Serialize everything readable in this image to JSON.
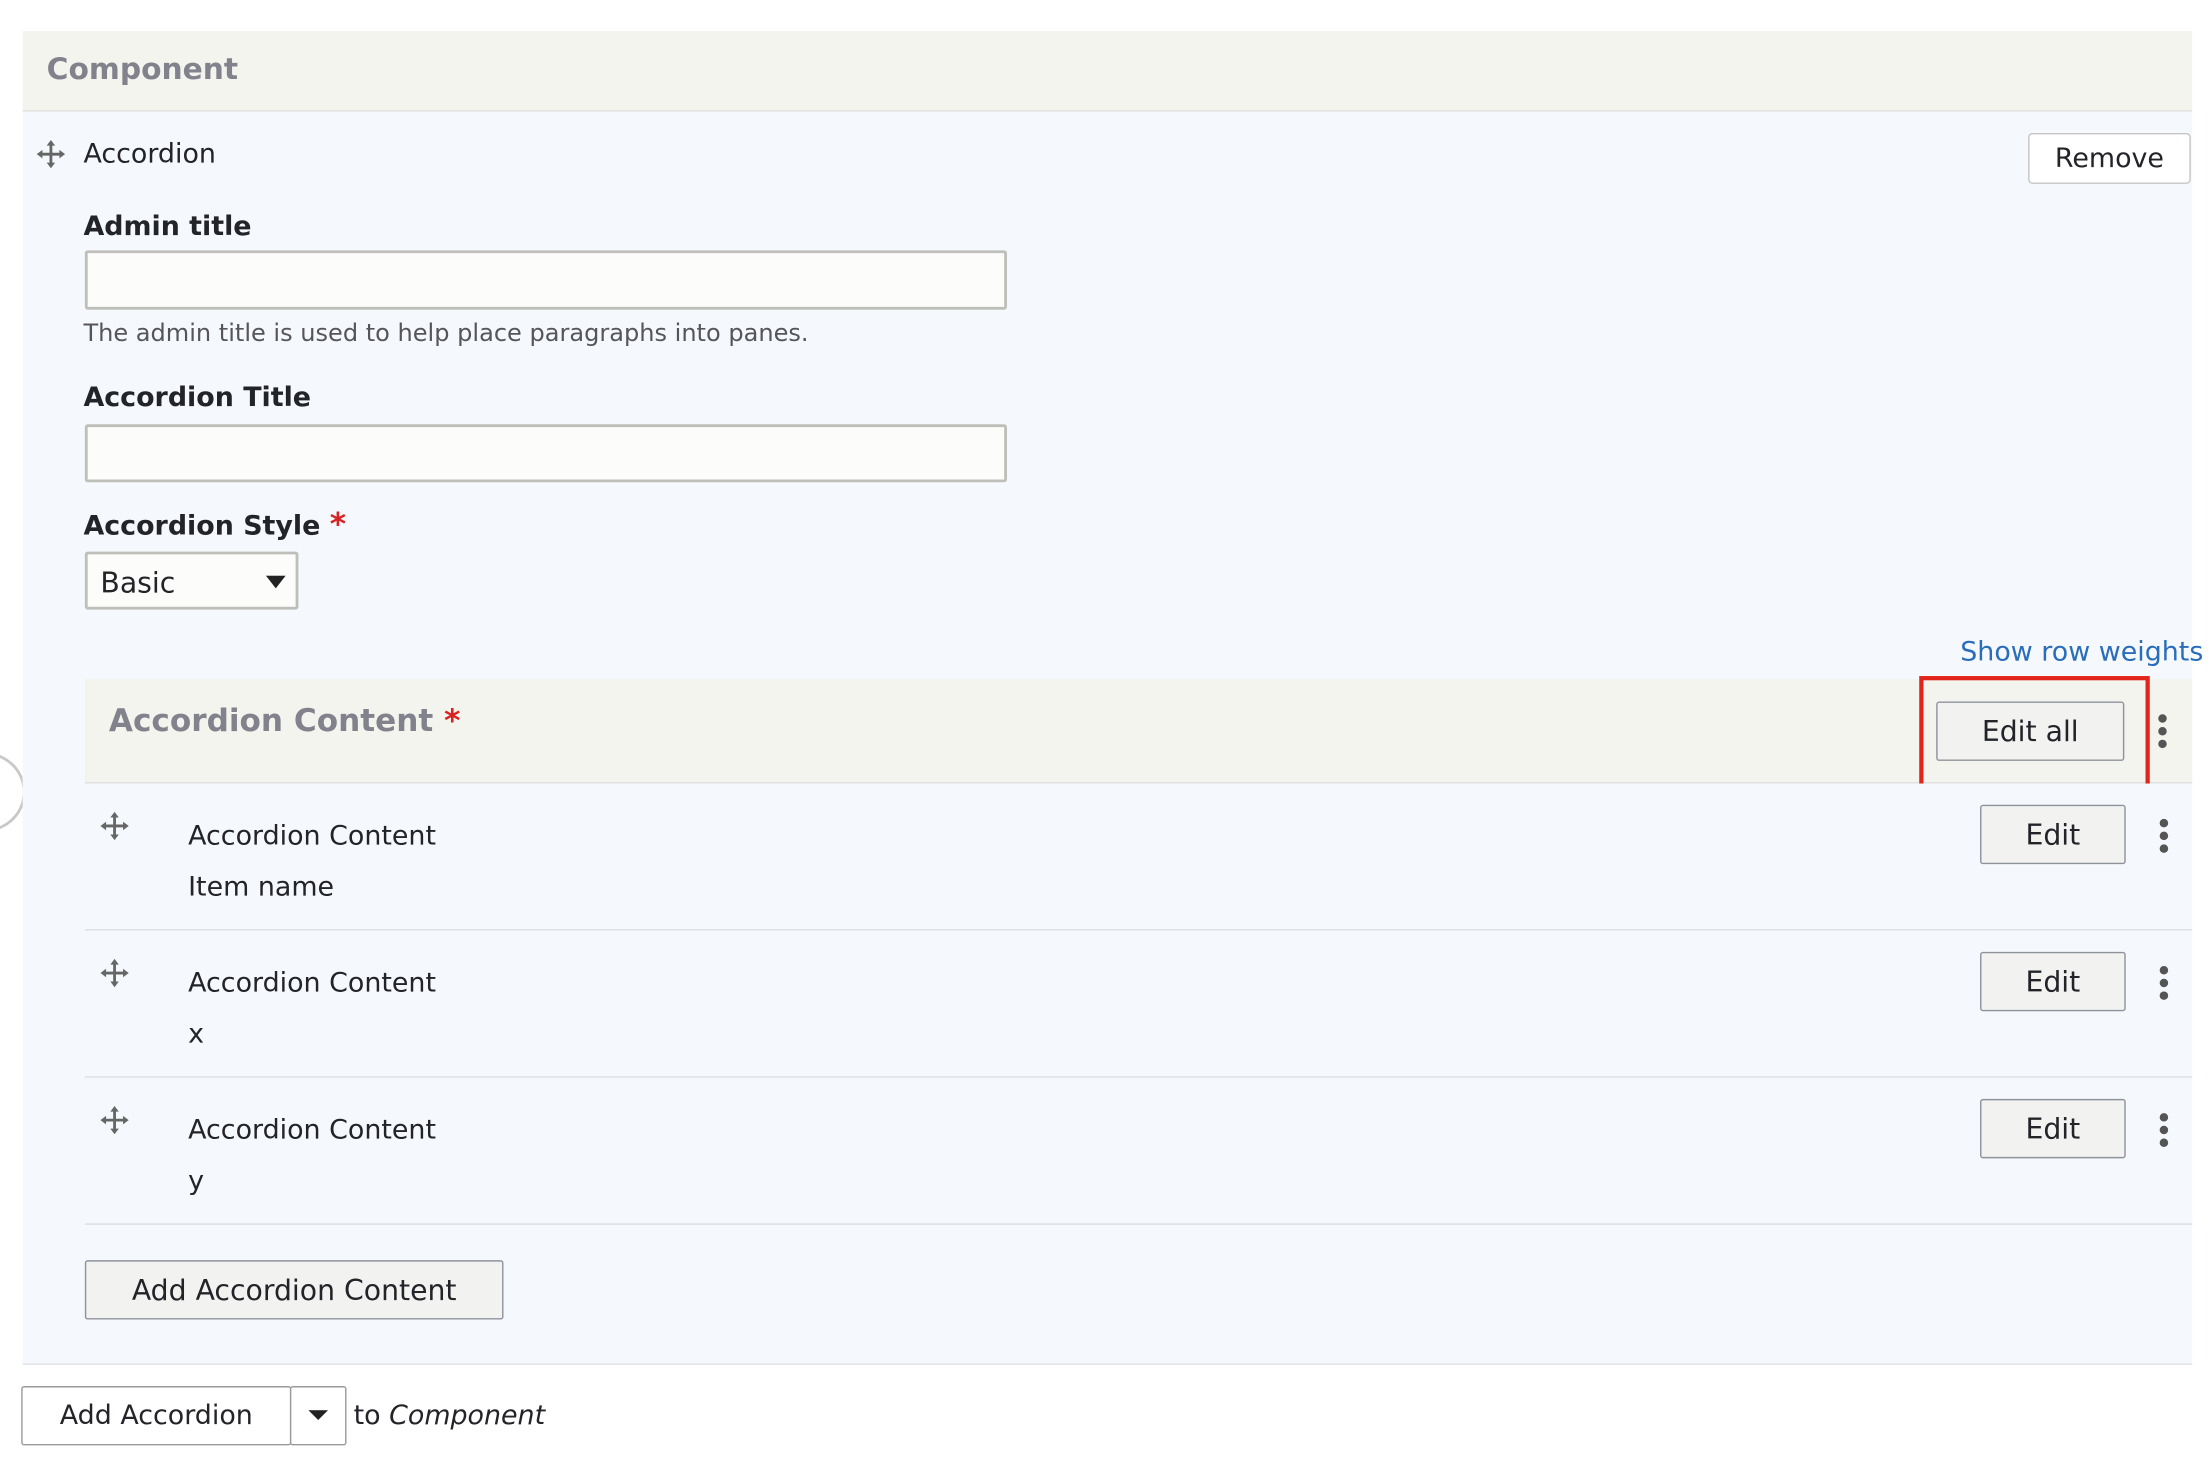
{
  "component": {
    "header": "Component",
    "item_title": "Accordion",
    "remove_label": "Remove",
    "admin_title": {
      "label": "Admin title",
      "value": "",
      "description": "The admin title is used to help place paragraphs into panes."
    },
    "accordion_title": {
      "label": "Accordion Title",
      "value": ""
    },
    "accordion_style": {
      "label": "Accordion Style",
      "required_mark": "*",
      "selected": "Basic"
    }
  },
  "show_row_weights": "Show row weights",
  "accordion_content": {
    "header": "Accordion Content",
    "required_mark": "*",
    "edit_all_label": "Edit all",
    "rows": [
      {
        "type": "Accordion Content",
        "name": "Item name",
        "edit_label": "Edit"
      },
      {
        "type": "Accordion Content",
        "name": "x",
        "edit_label": "Edit"
      },
      {
        "type": "Accordion Content",
        "name": "y",
        "edit_label": "Edit"
      }
    ],
    "add_label": "Add Accordion Content"
  },
  "footer": {
    "add_label": "Add Accordion",
    "to_text": "to",
    "target": "Component"
  },
  "colors": {
    "highlight": "#e1251b",
    "link": "#2a6ebb",
    "required": "#d72222"
  }
}
